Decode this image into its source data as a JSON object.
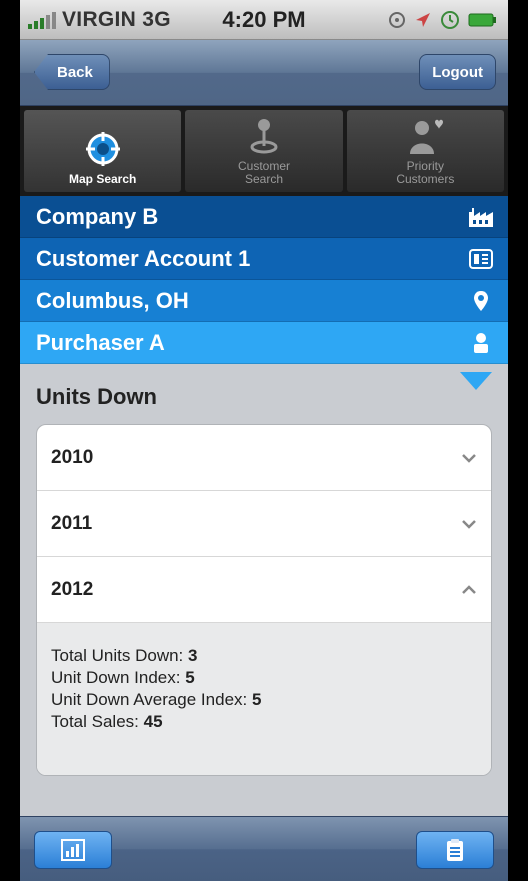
{
  "status_bar": {
    "carrier": "VIRGIN 3G",
    "time": "4:20 PM"
  },
  "nav": {
    "back_label": "Back",
    "logout_label": "Logout"
  },
  "tabs": [
    {
      "label_line1": "Map Search",
      "label_line2": "",
      "icon": "crosshair-icon",
      "active": true
    },
    {
      "label_line1": "Customer",
      "label_line2": "Search",
      "icon": "map-pin-icon",
      "active": false
    },
    {
      "label_line1": "Priority",
      "label_line2": "Customers",
      "icon": "person-heart-icon",
      "active": false
    }
  ],
  "breadcrumbs": [
    {
      "label": "Company B",
      "icon": "factory-icon",
      "color": "#0a4f93"
    },
    {
      "label": "Customer Account 1",
      "icon": "id-card-icon",
      "color": "#0e64b4"
    },
    {
      "label": "Columbus, OH",
      "icon": "location-pin-icon",
      "color": "#1780d3"
    },
    {
      "label": "Purchaser A",
      "icon": "person-icon",
      "color": "#2ea7f4"
    }
  ],
  "section_title": "Units Down",
  "accordion": {
    "rows": [
      {
        "year": "2010",
        "expanded": false
      },
      {
        "year": "2011",
        "expanded": false
      },
      {
        "year": "2012",
        "expanded": true
      }
    ],
    "details": [
      {
        "label": "Total Units Down:",
        "value": "3"
      },
      {
        "label": "Unit Down Index:",
        "value": "5"
      },
      {
        "label": "Unit Down Average Index:",
        "value": "5"
      },
      {
        "label": "Total Sales:",
        "value": "45"
      }
    ]
  },
  "toolbar": {
    "left_icon": "bar-chart-icon",
    "right_icon": "clipboard-icon"
  }
}
